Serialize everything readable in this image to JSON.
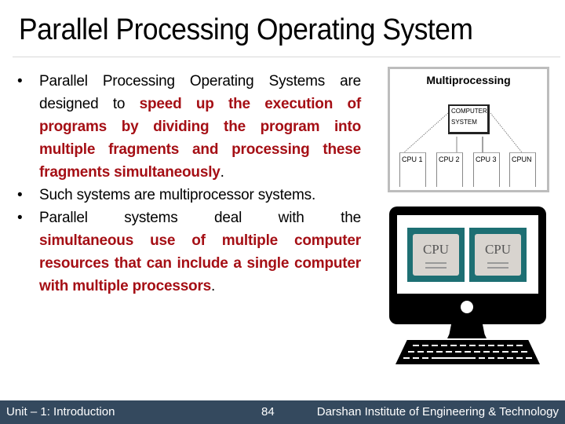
{
  "slide": {
    "title": "Parallel Processing Operating System",
    "bullets": [
      {
        "marker": "•",
        "parts": [
          {
            "text": "Parallel Processing Operating Systems are designed to ",
            "highlight": false
          },
          {
            "text": "speed up the execution of programs by dividing the program into multiple fragments and processing these fragments simultaneously",
            "highlight": true
          },
          {
            "text": ".",
            "highlight": false
          }
        ]
      },
      {
        "marker": "•",
        "parts": [
          {
            "text": "Such systems are multiprocessor systems.",
            "highlight": false
          }
        ]
      },
      {
        "marker": "•",
        "parts": [
          {
            "text": "Parallel systems deal with the ",
            "highlight": false
          },
          {
            "text": "simultaneous use of multiple computer resources that can include a single computer with multiple processors",
            "highlight": true
          },
          {
            "text": ".",
            "highlight": false
          }
        ]
      }
    ],
    "highlight_color": "#a50f15"
  },
  "diagram": {
    "title": "Multiprocessing",
    "computer_system_lines": [
      "COMPUTER",
      "SYSTEM"
    ],
    "cpus": [
      "CPU 1",
      "CPU 2",
      "CPU 3",
      "CPUN"
    ]
  },
  "illustration": {
    "chips": [
      "CPU",
      "CPU"
    ],
    "chip_color": "#1d6f73"
  },
  "footer": {
    "unit": "Unit – 1: Introduction",
    "page": "84",
    "institute": "Darshan Institute of Engineering & Technology",
    "background": "#34495e"
  }
}
